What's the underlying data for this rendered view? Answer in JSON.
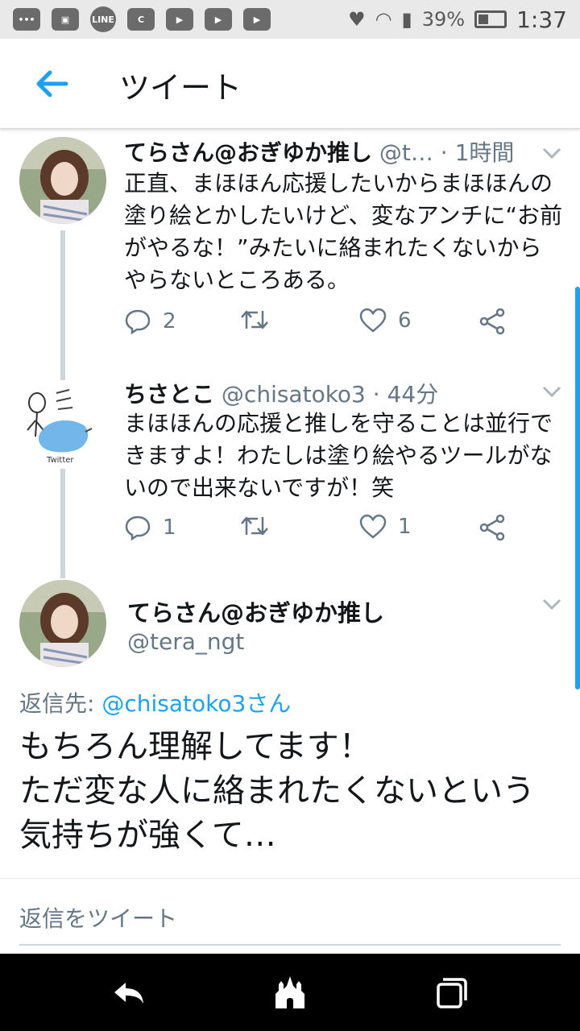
{
  "status_bar": {
    "left_icons": [
      "message-icon",
      "image-icon",
      "line-icon",
      "c-app-icon",
      "youtube-icon",
      "youtube-icon",
      "youtube-icon"
    ],
    "line_label": "LINE",
    "battery": "39%",
    "time": "1:37"
  },
  "appbar": {
    "title": "ツイート"
  },
  "tweets": [
    {
      "name": "てらさん@おぎゆか推し",
      "meta": "@t… · 1時間",
      "body": "正直、まほほん応援したいからまほほんの塗り絵とかしたいけど、変なアンチに“お前がやるな！”みたいに絡まれたくないからやらないところある。",
      "replies": "2",
      "retweets": "",
      "likes": "6"
    },
    {
      "name": "ちさとこ",
      "meta": "@chisatoko3 · 44分",
      "body": "まほほんの応援と推しを守ることは並行できますよ！わたしは塗り絵やるツールがないので出来ないですが！笑",
      "replies": "1",
      "retweets": "",
      "likes": "1",
      "avatar_text": "Twitter"
    }
  ],
  "focused_tweet": {
    "name": "てらさん@おぎゆか推し",
    "handle": "@tera_ngt",
    "replying_label": "返信先: ",
    "replying_to": "@chisatoko3さん",
    "line1": "もちろん理解してます！",
    "line2": "ただ変な人に絡まれたくないという気持ちが強くて…"
  },
  "composer": {
    "placeholder": "返信をツイート"
  },
  "colors": {
    "accent": "#1da1f2",
    "muted": "#657786",
    "text": "#14171a"
  }
}
